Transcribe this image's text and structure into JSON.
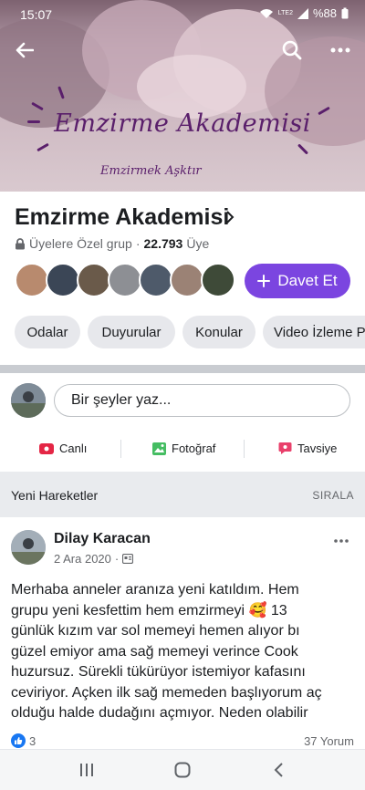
{
  "status_bar": {
    "time": "15:07",
    "network": "LTE2",
    "battery": "%88"
  },
  "cover": {
    "title": "Emzirme Akademisi",
    "subtitle": "Emzirmek Aşktır"
  },
  "group": {
    "name": "Emzirme Akademisi",
    "privacy": "Üyelere Özel grup",
    "separator": "·",
    "member_count": "22.793",
    "member_unit": "Üye",
    "invite_label": "Davet Et"
  },
  "tabs": [
    "Odalar",
    "Duyurular",
    "Konular",
    "Video İzleme P"
  ],
  "composer": {
    "placeholder": "Bir şeyler yaz...",
    "actions": {
      "live": "Canlı",
      "photo": "Fotoğraf",
      "recommend": "Tavsiye"
    }
  },
  "section": {
    "title": "Yeni Hareketler",
    "sort_label": "SIRALA"
  },
  "post": {
    "author": "Dilay Karacan",
    "date": "2 Ara 2020",
    "lines": [
      "Merhaba anneler aranıza yeni katıldım. Hem",
      "grupu yeni kesfettim hem emzirmeyi 🥰 13",
      "günlük kızım var sol memeyi hemen alıyor bı",
      "güzel emiyor ama sağ memeyi verince Cook",
      "huzursuz. Sürekli tükürüyor istemiyor kafasını",
      "ceviriyor. Açken ilk sağ memeden başlıyorum aç",
      "olduğu halde dudağını açmıyor. Neden olabilir"
    ],
    "reaction_count": "3",
    "comment_count": "37 Yorum"
  },
  "icons": {
    "back": "arrow-left-icon",
    "search": "search-icon",
    "more": "more-dots-icon",
    "lock": "lock-icon",
    "plus": "plus-icon",
    "live": "live-video-icon",
    "photo": "photo-icon",
    "recommend": "recommend-icon",
    "like": "like-icon",
    "audience": "audience-icon"
  },
  "colors": {
    "accent": "#7b45e0",
    "live": "#e42645",
    "photo": "#45bd62",
    "recommend": "#e9406b",
    "like": "#1877f2"
  }
}
